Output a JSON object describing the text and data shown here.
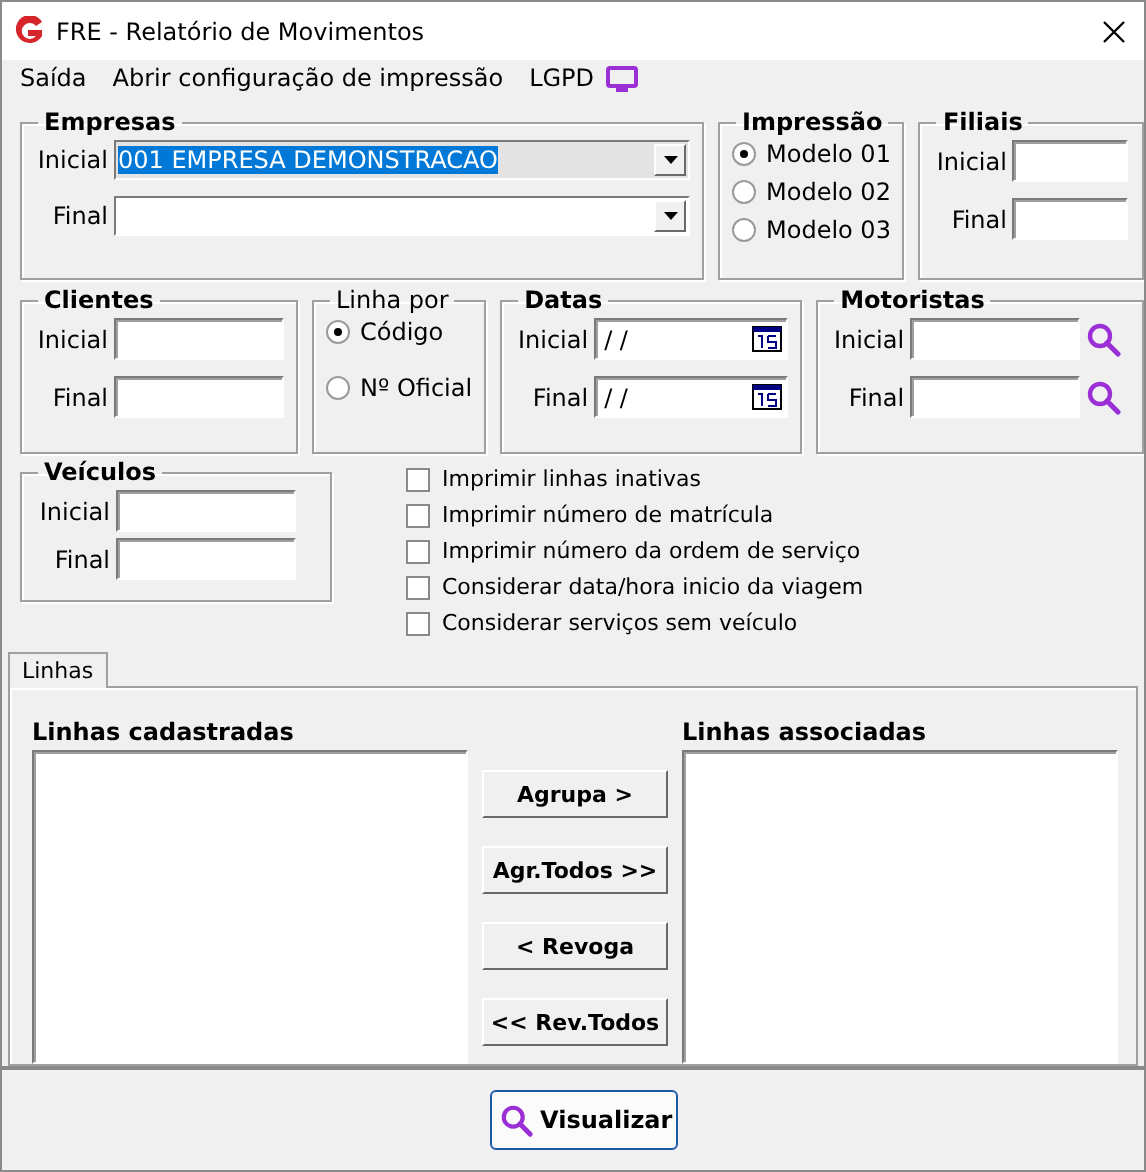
{
  "window": {
    "title": "FRE - Relatório de Movimentos"
  },
  "menu": [
    {
      "label": "Saída",
      "kind": "text"
    },
    {
      "label": "Abrir configuração de impressão",
      "kind": "text"
    },
    {
      "label": "LGPD",
      "kind": "monitor"
    }
  ],
  "empresas": {
    "title": "Empresas",
    "fields": [
      {
        "label": "Inicial",
        "value": "001 EMPRESA DEMONSTRACAO",
        "highlighted": true
      },
      {
        "label": "Final",
        "highlighted": false
      }
    ]
  },
  "impressao": {
    "title": "Impressão",
    "options": [
      {
        "label": "Modelo 01",
        "selected": true
      },
      {
        "label": "Modelo 02",
        "selected": false
      },
      {
        "label": "Modelo 03",
        "selected": false
      }
    ]
  },
  "filiais": {
    "title": "Filiais",
    "fields": [
      {
        "label": "Inicial"
      },
      {
        "label": "Final"
      }
    ]
  },
  "clientes": {
    "title": "Clientes",
    "fields": [
      {
        "label": "Inicial"
      },
      {
        "label": "Final"
      }
    ]
  },
  "linha_por": {
    "title": "Linha por",
    "options": [
      {
        "label": "Código",
        "selected": true
      },
      {
        "label": "Nº Oficial",
        "selected": false
      }
    ]
  },
  "datas": {
    "title": "Datas",
    "fields": [
      {
        "label": "Inicial",
        "value": "/ /"
      },
      {
        "label": "Final",
        "value": "/ /"
      }
    ]
  },
  "motoristas": {
    "title": "Motoristas",
    "fields": [
      {
        "label": "Inicial"
      },
      {
        "label": "Final"
      }
    ]
  },
  "veiculos": {
    "title": "Veículos",
    "fields": [
      {
        "label": "Inicial"
      },
      {
        "label": "Final"
      }
    ]
  },
  "options": [
    {
      "label": "Imprimir linhas inativas",
      "checked": false
    },
    {
      "label": "Imprimir número de matrícula",
      "checked": false
    },
    {
      "label": "Imprimir número da ordem de serviço",
      "checked": false
    },
    {
      "label": "Considerar data/hora inicio da viagem",
      "checked": false
    },
    {
      "label": "Considerar serviços sem veículo",
      "checked": false
    }
  ],
  "tabs": [
    {
      "label": "Linhas",
      "selected": true
    }
  ],
  "linhas_cadastradas": {
    "title": "Linhas cadastradas"
  },
  "linhas_associadas": {
    "title": "Linhas associadas"
  },
  "transfer_buttons": [
    {
      "label": "Agrupa >"
    },
    {
      "label": "Agr.Todos >>"
    },
    {
      "label": "< Revoga"
    },
    {
      "label": "<< Rev.Todos"
    }
  ],
  "visualizar": {
    "label": "Visualizar"
  }
}
